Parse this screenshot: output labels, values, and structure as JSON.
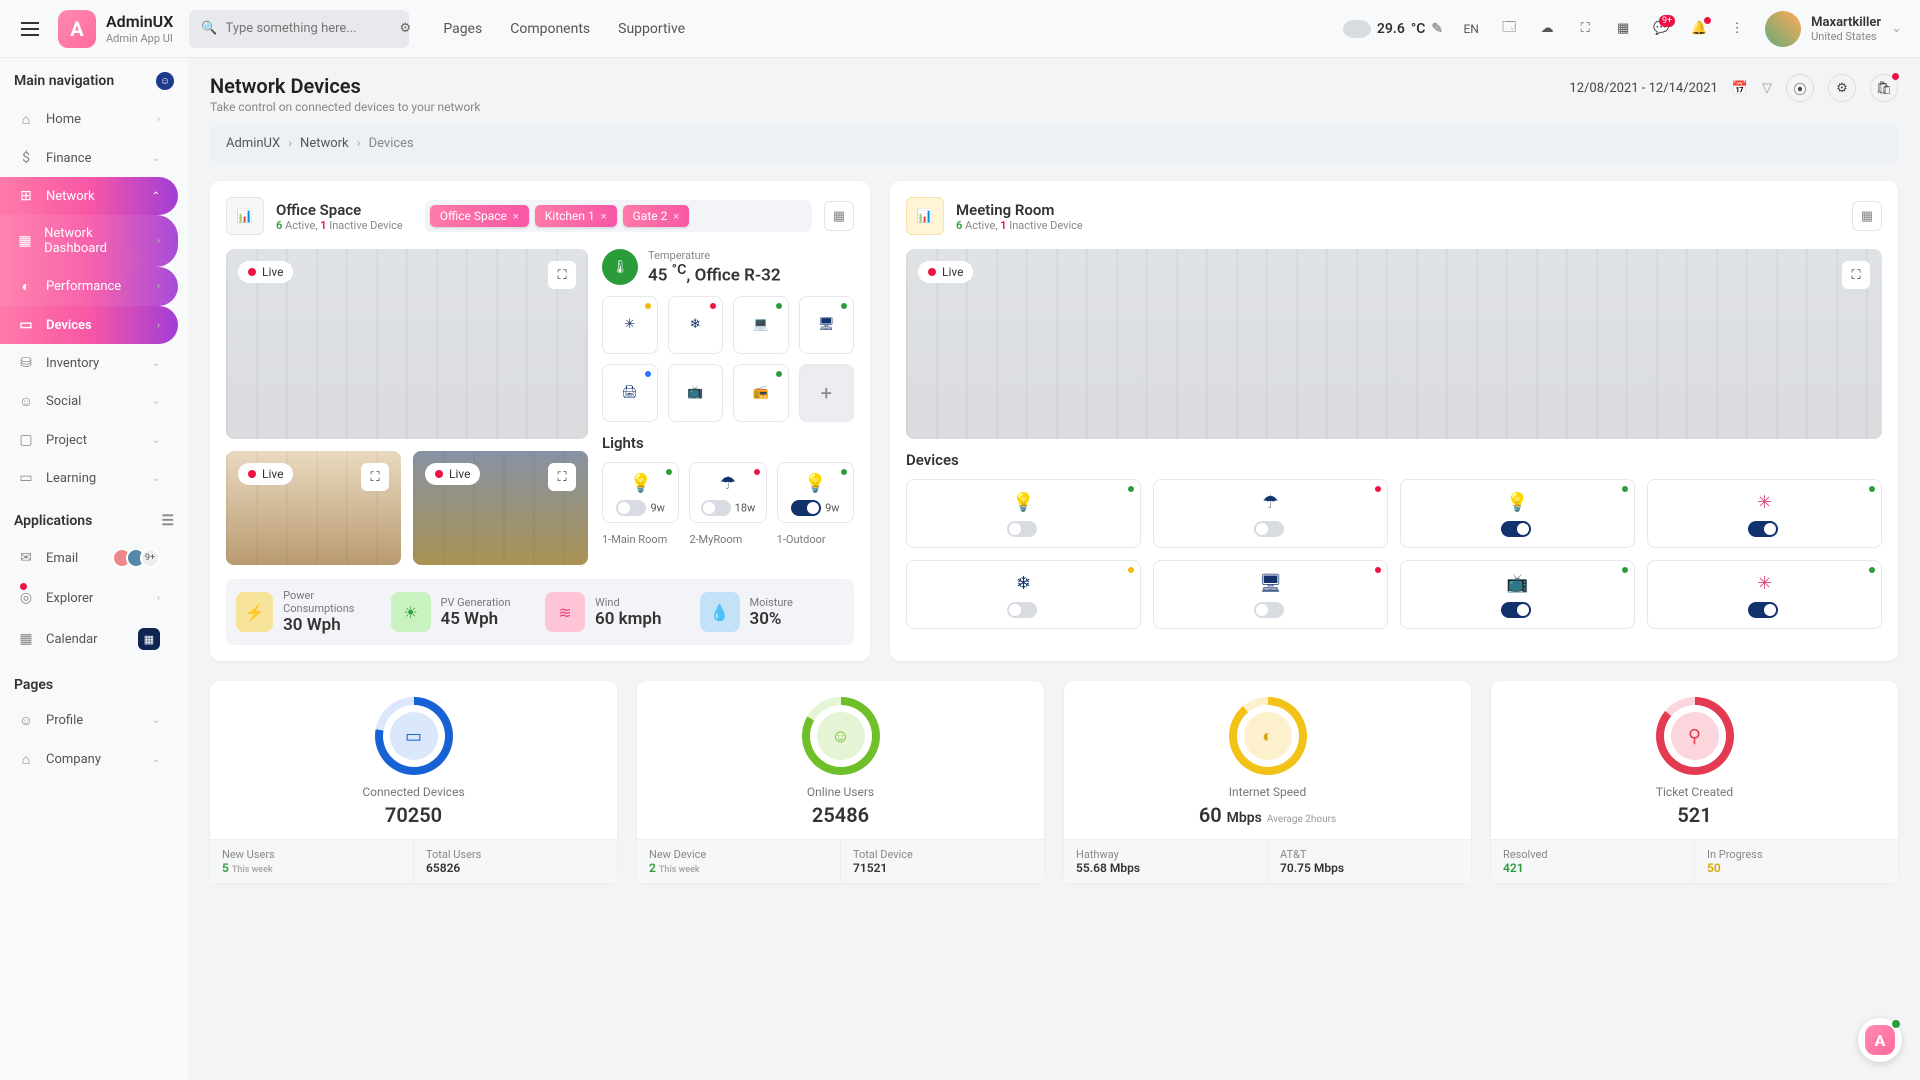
{
  "brand": {
    "name": "AdminUX",
    "sub": "Admin App UI",
    "logo_letter": "A"
  },
  "search": {
    "placeholder": "Type something here..."
  },
  "topnav": [
    "Pages",
    "Components",
    "Supportive"
  ],
  "weather": {
    "temp": "29.6",
    "unit": "°C"
  },
  "lang": "EN",
  "msg_badge": "9+",
  "user": {
    "name": "Maxartkiller",
    "loc": "United States"
  },
  "side": {
    "hdr": "Main navigation",
    "items": [
      {
        "label": "Home",
        "ico": "⌂"
      },
      {
        "label": "Finance",
        "ico": "$"
      },
      {
        "label": "Network",
        "ico": "⊞",
        "active": true,
        "sub": [
          {
            "label": "Network Dashboard",
            "ico": "▦"
          },
          {
            "label": "Performance",
            "ico": "◐"
          },
          {
            "label": "Devices",
            "ico": "▭",
            "active": true
          }
        ]
      },
      {
        "label": "Inventory",
        "ico": "⛁"
      },
      {
        "label": "Social",
        "ico": "☺"
      },
      {
        "label": "Project",
        "ico": "▢"
      },
      {
        "label": "Learning",
        "ico": "▭"
      }
    ],
    "apps_hdr": "Applications",
    "apps": [
      {
        "label": "Email",
        "ico": "✉",
        "avatars": true,
        "count": "9+"
      },
      {
        "label": "Explorer",
        "ico": "◎",
        "dot": true
      },
      {
        "label": "Calendar",
        "ico": "▦",
        "badge": "▦"
      }
    ],
    "pages_hdr": "Pages",
    "pages": [
      {
        "label": "Profile",
        "ico": "☺"
      },
      {
        "label": "Company",
        "ico": "⌂"
      }
    ]
  },
  "page": {
    "title": "Network Devices",
    "subtitle": "Take control on connected devices to your network",
    "daterange": "12/08/2021 - 12/14/2021",
    "crumbs": [
      "AdminUX",
      "Network",
      "Devices"
    ]
  },
  "office": {
    "title": "Office Space",
    "active": "6",
    "inactive": "1",
    "sub_tail": " Device",
    "chips": [
      "Office Space",
      "Kitchen 1",
      "Gate 2"
    ],
    "live": "Live",
    "temp": {
      "label": "Temperature",
      "value": "45",
      "unit": "°C",
      "room": ", Office R-32"
    },
    "devs": [
      {
        "ico": "fan",
        "dot": "y"
      },
      {
        "ico": "snow",
        "dot": "r"
      },
      {
        "ico": "laptop",
        "dot": "g"
      },
      {
        "ico": "desktop",
        "dot": "g"
      },
      {
        "ico": "printer",
        "dot": "b"
      },
      {
        "ico": "cast",
        "dot": ""
      },
      {
        "ico": "radio",
        "dot": "g"
      },
      {
        "ico": "plus",
        "dot": ""
      }
    ],
    "lights_title": "Lights",
    "lights": [
      {
        "ico": "bulb",
        "w": "9w",
        "name": "1-Main Room",
        "on": false,
        "dot": "g"
      },
      {
        "ico": "lamp",
        "w": "18w",
        "name": "2-MyRoom",
        "on": false,
        "dot": "r"
      },
      {
        "ico": "bulb",
        "w": "9w",
        "name": "1-Outdoor",
        "on": true,
        "dot": "g"
      }
    ],
    "stats": [
      {
        "ico": "bolt",
        "cls": "si-y",
        "l": "Power Consumptions",
        "v": "30 Wph"
      },
      {
        "ico": "sun",
        "cls": "si-g",
        "l": "PV Generation",
        "v": "45 Wph"
      },
      {
        "ico": "wind",
        "cls": "si-p",
        "l": "Wind",
        "v": "60 kmph"
      },
      {
        "ico": "drop",
        "cls": "si-b",
        "l": "Moisture",
        "v": "30%"
      }
    ]
  },
  "meeting": {
    "title": "Meeting Room",
    "active": "6",
    "inactive": "1",
    "sub_tail": " Device",
    "live": "Live",
    "devs_title": "Devices",
    "devs": [
      {
        "ico": "bulb",
        "on": false,
        "dot": "g"
      },
      {
        "ico": "lamp",
        "on": false,
        "dot": "r"
      },
      {
        "ico": "bulb",
        "on": true,
        "dot": "g",
        "cls": ""
      },
      {
        "ico": "fan",
        "on": true,
        "dot": "g",
        "cls": "pink"
      },
      {
        "ico": "snow",
        "on": false,
        "dot": "y"
      },
      {
        "ico": "desktop",
        "on": false,
        "dot": "r"
      },
      {
        "ico": "cast",
        "on": true,
        "dot": "g"
      },
      {
        "ico": "fan",
        "on": true,
        "dot": "g",
        "cls": "pink"
      }
    ]
  },
  "metrics": [
    {
      "ring": "r-blue",
      "ico": "▭",
      "l": "Connected Devices",
      "v": "70250",
      "foot": [
        {
          "l": "New Users",
          "v": "5",
          "t": "This week",
          "cls": "g"
        },
        {
          "l": "Total Users",
          "v": "65826"
        }
      ]
    },
    {
      "ring": "r-green",
      "ico": "☺",
      "l": "Online Users",
      "v": "25486",
      "foot": [
        {
          "l": "New Device",
          "v": "2",
          "t": "This week",
          "cls": "g"
        },
        {
          "l": "Total Device",
          "v": "71521"
        }
      ]
    },
    {
      "ring": "r-yellow",
      "ico": "◐",
      "l": "Internet Speed",
      "v": "60",
      "unit": "Mbps",
      "note": "Average 2hours",
      "foot": [
        {
          "l": "Hathway",
          "v": "55.68 Mbps"
        },
        {
          "l": "AT&T",
          "v": "70.75 Mbps"
        }
      ]
    },
    {
      "ring": "r-red",
      "ico": "⚲",
      "l": "Ticket Created",
      "v": "521",
      "foot": [
        {
          "l": "Resolved",
          "v": "421",
          "cls": "g"
        },
        {
          "l": "In Progress",
          "v": "50",
          "cls": "y"
        }
      ]
    }
  ]
}
